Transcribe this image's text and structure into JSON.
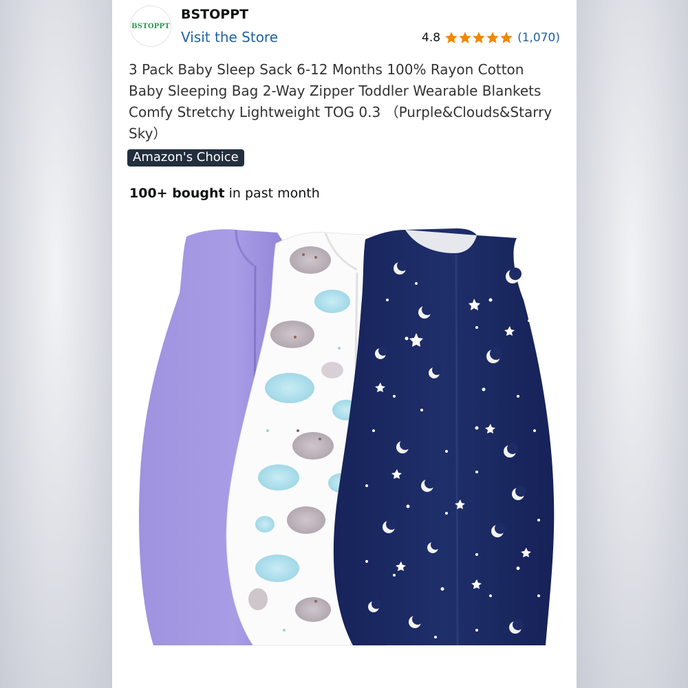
{
  "seller": {
    "logo_text": "BSTOPPT",
    "name": "BSTOPPT",
    "store_link": "Visit the Store"
  },
  "rating": {
    "value": "4.8",
    "stars": 5,
    "review_count": "(1,070)",
    "star_color": "#f08804"
  },
  "product": {
    "title": "3 Pack Baby Sleep Sack 6-12 Months 100% Rayon Cotton Baby Sleeping Bag 2-Way Zipper Toddler Wearable Blankets Comfy Stretchy Lightweight TOG 0.3 （Purple&Clouds&Starry Sky）",
    "badge": "Amazon's Choice",
    "bought_bold": "100+ bought",
    "bought_rest": " in past month",
    "image_colors": {
      "purple": "#9d90dd",
      "clouds_bg": "#fbfbfb",
      "navy": "#1c2b63"
    }
  },
  "colors": {
    "link": "#2162a1",
    "badge_bg": "#232f3e"
  }
}
